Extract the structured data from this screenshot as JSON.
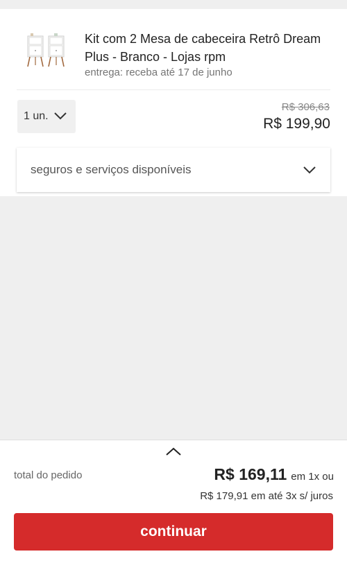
{
  "product": {
    "title": "Kit com 2 Mesa de cabeceira Retrô Dream Plus - Branco - Lojas rpm",
    "delivery": "entrega: receba até 17 de junho",
    "quantity": "1 un.",
    "old_price": "R$ 306,63",
    "price": "R$ 199,90"
  },
  "services": {
    "label": "seguros e serviços disponíveis"
  },
  "summary": {
    "total_label": "total do pedido",
    "total_value": "R$ 169,11",
    "total_suffix": "em 1x ou",
    "installments": "R$ 179,91 em até 3x s/ juros",
    "cta_label": "continuar"
  },
  "colors": {
    "accent": "#d52b2b",
    "background": "#efefef"
  },
  "icons": {
    "quantity_dropdown": "chevron-down-icon",
    "services_dropdown": "chevron-down-icon",
    "summary_expand": "chevron-up-icon"
  }
}
